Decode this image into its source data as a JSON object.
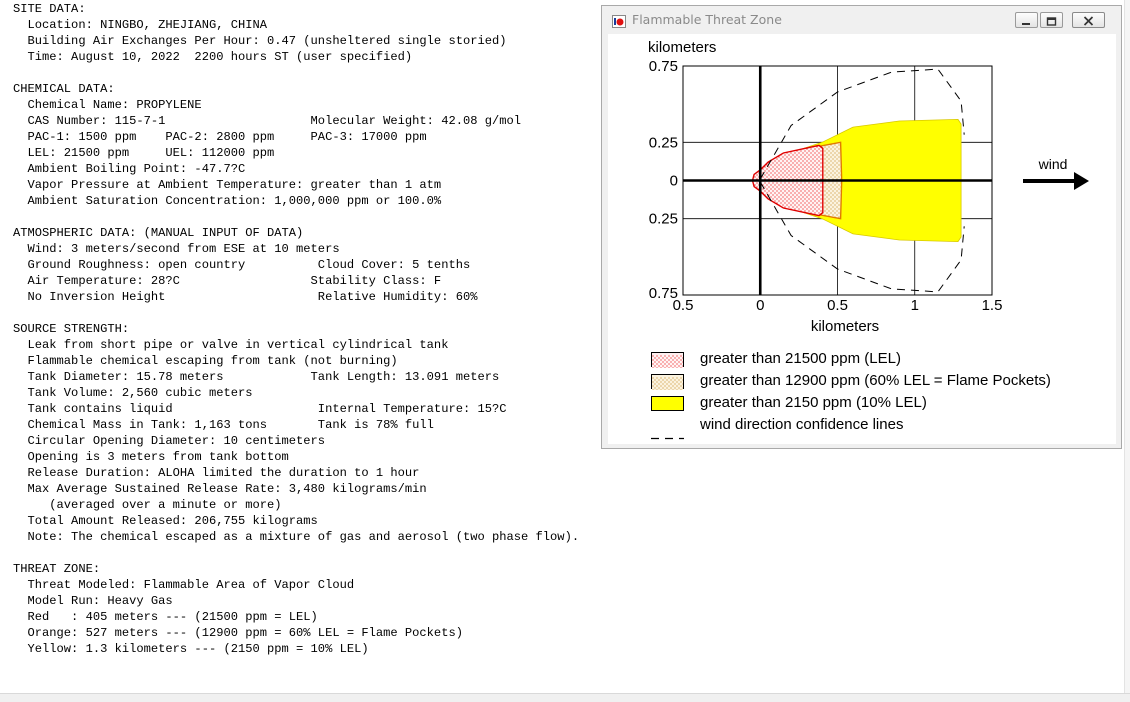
{
  "report": {
    "lines": [
      "SITE DATA:",
      "  Location: NINGBO, ZHEJIANG, CHINA",
      "  Building Air Exchanges Per Hour: 0.47 (unsheltered single storied)",
      "  Time: August 10, 2022  2200 hours ST (user specified)",
      "",
      "CHEMICAL DATA:",
      "  Chemical Name: PROPYLENE",
      "  CAS Number: 115-7-1                    Molecular Weight: 42.08 g/mol",
      "  PAC-1: 1500 ppm    PAC-2: 2800 ppm     PAC-3: 17000 ppm",
      "  LEL: 21500 ppm     UEL: 112000 ppm",
      "  Ambient Boiling Point: -47.7?C",
      "  Vapor Pressure at Ambient Temperature: greater than 1 atm",
      "  Ambient Saturation Concentration: 1,000,000 ppm or 100.0%",
      "",
      "ATMOSPHERIC DATA: (MANUAL INPUT OF DATA)",
      "  Wind: 3 meters/second from ESE at 10 meters",
      "  Ground Roughness: open country          Cloud Cover: 5 tenths",
      "  Air Temperature: 28?C                  Stability Class: F",
      "  No Inversion Height                     Relative Humidity: 60%",
      "",
      "SOURCE STRENGTH:",
      "  Leak from short pipe or valve in vertical cylindrical tank",
      "  Flammable chemical escaping from tank (not burning)",
      "  Tank Diameter: 15.78 meters            Tank Length: 13.091 meters",
      "  Tank Volume: 2,560 cubic meters",
      "  Tank contains liquid                    Internal Temperature: 15?C",
      "  Chemical Mass in Tank: 1,163 tons       Tank is 78% full",
      "  Circular Opening Diameter: 10 centimeters",
      "  Opening is 3 meters from tank bottom",
      "  Release Duration: ALOHA limited the duration to 1 hour",
      "  Max Average Sustained Release Rate: 3,480 kilograms/min",
      "     (averaged over a minute or more)",
      "  Total Amount Released: 206,755 kilograms",
      "  Note: The chemical escaped as a mixture of gas and aerosol (two phase flow).",
      "",
      "THREAT ZONE:",
      "  Threat Modeled: Flammable Area of Vapor Cloud",
      "  Model Run: Heavy Gas",
      "  Red   : 405 meters --- (21500 ppm = LEL)",
      "  Orange: 527 meters --- (12900 ppm = 60% LEL = Flame Pockets)",
      "  Yellow: 1.3 kilometers --- (2150 ppm = 10% LEL)"
    ]
  },
  "window": {
    "title": "Flammable Threat Zone",
    "icons": {
      "app": "aloha-app-icon",
      "minimize": "minimize-icon",
      "maximize": "maximize-icon",
      "close": "close-icon"
    }
  },
  "chart_data": {
    "type": "area",
    "xlabel": "kilometers",
    "ylabel": "kilometers",
    "xlim": [
      -0.5,
      1.5
    ],
    "ylim": [
      -0.75,
      0.75
    ],
    "x_ticks": [
      {
        "v": -0.5,
        "label": "0.5"
      },
      {
        "v": 0,
        "label": "0"
      },
      {
        "v": 0.5,
        "label": "0.5"
      },
      {
        "v": 1,
        "label": "1"
      },
      {
        "v": 1.5,
        "label": "1.5"
      }
    ],
    "y_ticks": [
      {
        "v": 0.75,
        "label": "0.75"
      },
      {
        "v": 0.25,
        "label": "0.25"
      },
      {
        "v": 0,
        "label": "0"
      },
      {
        "v": -0.25,
        "label": "0.25"
      },
      {
        "v": -0.75,
        "label": "0.75"
      }
    ],
    "grid": true,
    "zones": [
      {
        "name": "Yellow",
        "color": "#ffff00",
        "pattern": "solid",
        "max_distance_km": 1.3,
        "outline": [
          [
            -0.02,
            0
          ],
          [
            0.02,
            0.05
          ],
          [
            0.1,
            0.13
          ],
          [
            0.25,
            0.2
          ],
          [
            0.4,
            0.25
          ],
          [
            0.6,
            0.35
          ],
          [
            0.9,
            0.39
          ],
          [
            1.28,
            0.4
          ],
          [
            1.3,
            0.37
          ],
          [
            1.3,
            -0.37
          ],
          [
            1.28,
            -0.4
          ],
          [
            0.9,
            -0.39
          ],
          [
            0.6,
            -0.35
          ],
          [
            0.4,
            -0.25
          ],
          [
            0.25,
            -0.2
          ],
          [
            0.1,
            -0.13
          ],
          [
            0.02,
            -0.05
          ]
        ]
      },
      {
        "name": "Orange",
        "color": "#f5deb3",
        "pattern": "dots",
        "max_distance_km": 0.527,
        "outline": [
          [
            -0.02,
            0
          ],
          [
            0.02,
            0.05
          ],
          [
            0.1,
            0.13
          ],
          [
            0.25,
            0.2
          ],
          [
            0.52,
            0.25
          ],
          [
            0.527,
            0
          ],
          [
            0.52,
            -0.25
          ],
          [
            0.25,
            -0.2
          ],
          [
            0.1,
            -0.13
          ],
          [
            0.02,
            -0.05
          ]
        ]
      },
      {
        "name": "Red",
        "color": "#ff0000",
        "pattern": "dots",
        "max_distance_km": 0.405,
        "outline": [
          [
            -0.05,
            0
          ],
          [
            -0.04,
            0.04
          ],
          [
            0,
            0.07
          ],
          [
            0.05,
            0.12
          ],
          [
            0.15,
            0.18
          ],
          [
            0.38,
            0.23
          ],
          [
            0.405,
            0.21
          ],
          [
            0.405,
            -0.21
          ],
          [
            0.38,
            -0.23
          ],
          [
            0.15,
            -0.18
          ],
          [
            0.05,
            -0.12
          ],
          [
            0,
            -0.07
          ],
          [
            -0.04,
            -0.04
          ]
        ]
      }
    ],
    "confidence_lines": {
      "upper": [
        [
          0,
          0.01
        ],
        [
          0.2,
          0.36
        ],
        [
          0.5,
          0.58
        ],
        [
          0.85,
          0.71
        ],
        [
          1.15,
          0.73
        ],
        [
          1.3,
          0.52
        ],
        [
          1.32,
          0.3
        ]
      ],
      "lower": [
        [
          0,
          -0.01
        ],
        [
          0.2,
          -0.36
        ],
        [
          0.5,
          -0.58
        ],
        [
          0.85,
          -0.71
        ],
        [
          1.15,
          -0.73
        ],
        [
          1.3,
          -0.52
        ],
        [
          1.32,
          -0.3
        ]
      ]
    },
    "wind_label": "wind",
    "legend": [
      {
        "label": "greater than 21500 ppm (LEL)",
        "swatch": "red-dots"
      },
      {
        "label": "greater than 12900 ppm (60% LEL = Flame Pockets)",
        "swatch": "orange-dots"
      },
      {
        "label": "greater than 2150 ppm (10% LEL)",
        "swatch": "yellow-solid"
      },
      {
        "label": "wind direction confidence lines",
        "swatch": "dashed-line"
      }
    ]
  }
}
